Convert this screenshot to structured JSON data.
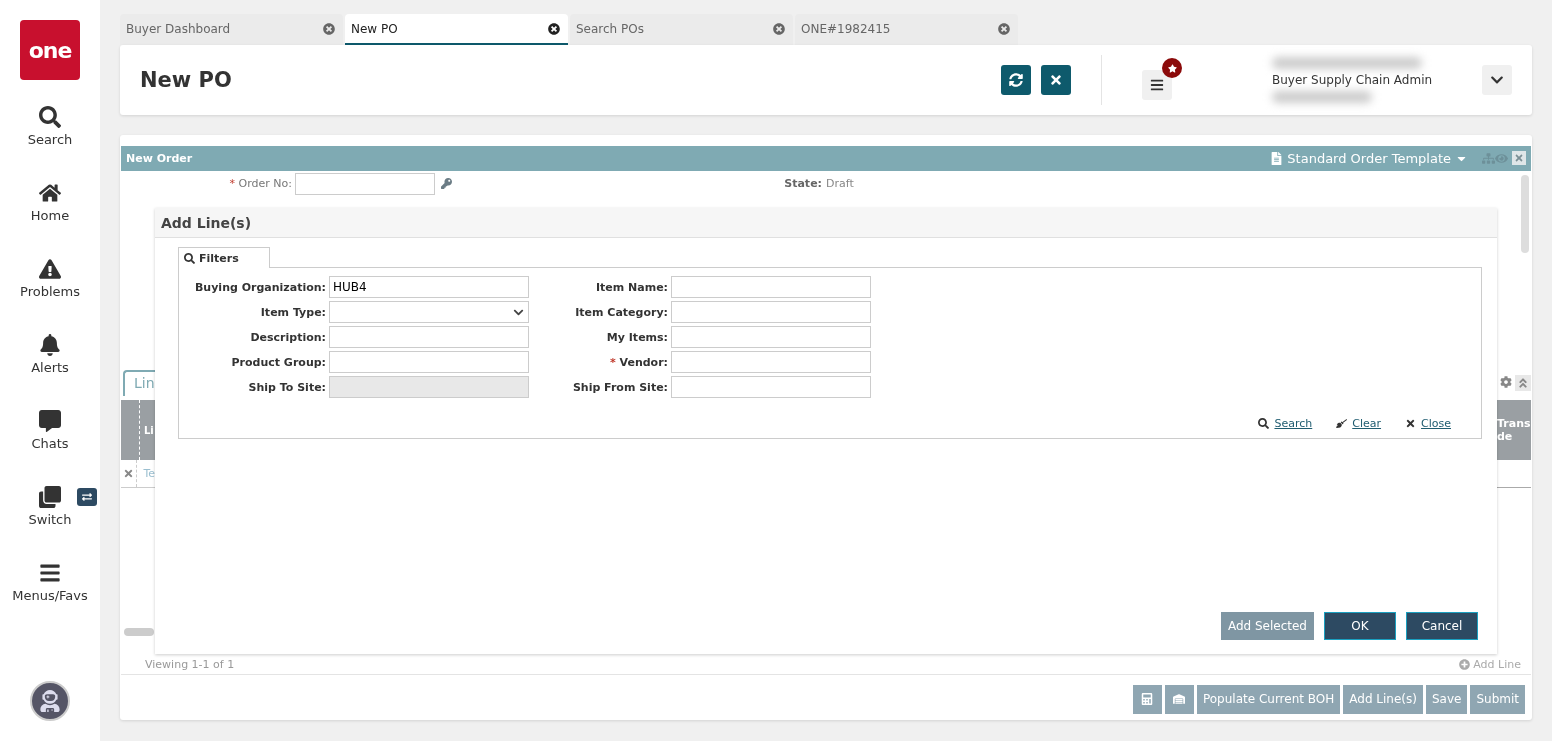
{
  "sidebar": {
    "logo": "one",
    "items": [
      {
        "label": "Search",
        "kind": "search"
      },
      {
        "label": "Home",
        "kind": "home"
      },
      {
        "label": "Problems",
        "kind": "problems"
      },
      {
        "label": "Alerts",
        "kind": "alerts"
      },
      {
        "label": "Chats",
        "kind": "chats"
      },
      {
        "label": "Switch",
        "kind": "switch"
      },
      {
        "label": "Menus/Favs",
        "kind": "menus"
      }
    ]
  },
  "tabs": [
    {
      "label": "Buyer Dashboard",
      "selected": false
    },
    {
      "label": "New PO",
      "selected": true
    },
    {
      "label": "Search POs",
      "selected": false
    },
    {
      "label": "ONE#1982415",
      "selected": false
    }
  ],
  "header": {
    "title": "New PO",
    "user_role": "Buyer Supply Chain Admin"
  },
  "order_panel": {
    "required_mark": "*",
    "title": "New Order",
    "template": "Standard Order Template",
    "order_no_label": "Order No:",
    "state_label": "State:",
    "state_value": "Draft"
  },
  "lines": {
    "tab": "Lin",
    "column_left": "Li",
    "column_right": [
      "Trans",
      "de"
    ],
    "row_cell": "Te",
    "viewing": "Viewing 1-1 of 1",
    "add_line": "Add Line"
  },
  "footer_buttons": [
    {
      "kind": "calculator"
    },
    {
      "kind": "warehouse"
    },
    {
      "kind": "text",
      "label": "Populate Current BOH"
    },
    {
      "kind": "text",
      "label": "Add Line(s)"
    },
    {
      "kind": "text",
      "label": "Save"
    },
    {
      "kind": "text",
      "label": "Submit"
    }
  ],
  "dialog": {
    "required_mark": "*",
    "title": "Add Line(s)",
    "filter_tab": "Filters",
    "left_fields": [
      {
        "label": "Buying Organization:",
        "value": "HUB4",
        "required": false,
        "kind": "text"
      },
      {
        "label": "Item Type:",
        "required": false,
        "kind": "select"
      },
      {
        "label": "Description:",
        "required": false,
        "kind": "text"
      },
      {
        "label": "Product Group:",
        "required": false,
        "kind": "text"
      },
      {
        "label": "Ship To Site:",
        "required": false,
        "kind": "disabled"
      }
    ],
    "right_fields": [
      {
        "label": "Item Name:",
        "required": false,
        "kind": "text"
      },
      {
        "label": "Item Category:",
        "required": false,
        "kind": "text"
      },
      {
        "label": "My Items:",
        "required": false,
        "kind": "text"
      },
      {
        "label": "Vendor:",
        "required": true,
        "kind": "text"
      },
      {
        "label": "Ship From Site:",
        "required": false,
        "kind": "text"
      }
    ],
    "links": [
      {
        "label": "Search",
        "kind": "search"
      },
      {
        "label": "Clear",
        "kind": "clear"
      },
      {
        "label": "Close",
        "kind": "close"
      }
    ],
    "buttons": [
      {
        "label": "Add Selected",
        "kind": "secondary"
      },
      {
        "label": "OK",
        "kind": "primary"
      },
      {
        "label": "Cancel",
        "kind": "primary"
      }
    ]
  }
}
